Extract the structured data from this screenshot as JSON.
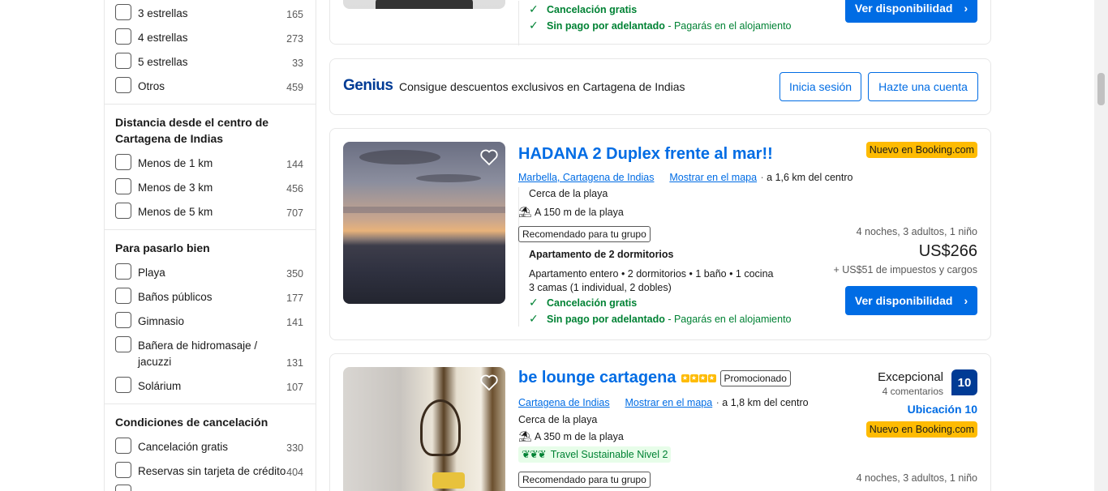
{
  "sidebar": {
    "stars": [
      {
        "label": "3 estrellas",
        "count": "165"
      },
      {
        "label": "4 estrellas",
        "count": "273"
      },
      {
        "label": "5 estrellas",
        "count": "33"
      },
      {
        "label": "Otros",
        "count": "459"
      }
    ],
    "distance": {
      "title": "Distancia desde el centro de Cartagena de Indias",
      "items": [
        {
          "label": "Menos de 1 km",
          "count": "144"
        },
        {
          "label": "Menos de 3 km",
          "count": "456"
        },
        {
          "label": "Menos de 5 km",
          "count": "707"
        }
      ]
    },
    "fun": {
      "title": "Para pasarlo bien",
      "items": [
        {
          "label": "Playa",
          "count": "350"
        },
        {
          "label": "Baños públicos",
          "count": "177"
        },
        {
          "label": "Gimnasio",
          "count": "141"
        },
        {
          "label": "Bañera de hidromasaje / jacuzzi",
          "count": "131"
        },
        {
          "label": "Solárium",
          "count": "107"
        }
      ]
    },
    "cancel": {
      "title": "Condiciones de cancelación",
      "items": [
        {
          "label": "Cancelación gratis",
          "count": "330"
        },
        {
          "label": "Reservas sin tarjeta de crédito",
          "count": "404"
        }
      ]
    }
  },
  "card_top": {
    "free_cancel": "Cancelación gratis",
    "no_prepay": "Sin pago por adelantado",
    "pay_at_property": " - Pagarás en el alojamiento",
    "button": "Ver disponibilidad"
  },
  "genius": {
    "logo": "Genius",
    "text": "Consigue descuentos exclusivos en Cartagena de Indias",
    "signin": "Inicia sesión",
    "signup": "Hazte una cuenta"
  },
  "hadana": {
    "title": "HADANA 2 Duplex frente al mar!!",
    "location": "Marbella, Cartagena de Indias",
    "map_link": "Mostrar en el mapa",
    "distance": "a 1,6 km del centro",
    "near_beach": "Cerca de la playa",
    "beach_distance": "A 150 m de la playa",
    "group_badge": "Recomendado para tu grupo",
    "room_type": "Apartamento de 2 dormitorios",
    "room_details": "Apartamento entero • 2 dormitorios • 1 baño • 1 cocina",
    "beds": "3 camas (1 individual, 2 dobles)",
    "free_cancel": "Cancelación gratis",
    "no_prepay": "Sin pago por adelantado",
    "pay_at_property": " - Pagarás en el alojamiento",
    "new_badge": "Nuevo en Booking.com",
    "stay": "4 noches, 3 adultos, 1 niño",
    "price": "US$266",
    "taxes": "+ US$51 de impuestos y cargos",
    "button": "Ver disponibilidad"
  },
  "belounge": {
    "title": "be lounge cartagena",
    "promo": "Promocionado",
    "location": "Cartagena de Indias",
    "map_link": "Mostrar en el mapa",
    "distance": "a 1,8 km del centro",
    "near_beach": "Cerca de la playa",
    "beach_distance": "A 350 m de la playa",
    "sustainable": "Travel Sustainable Nivel 2",
    "group_badge": "Recomendado para tu grupo",
    "rating_word": "Excepcional",
    "reviews": "4 comentarios",
    "score": "10",
    "location_score": "Ubicación 10",
    "new_badge": "Nuevo en Booking.com",
    "stay": "4 noches, 3 adultos, 1 niño"
  },
  "colors": {
    "accent": "#006ce4",
    "brand_dark": "#003b95",
    "green": "#008234",
    "yellow": "#febb02"
  }
}
